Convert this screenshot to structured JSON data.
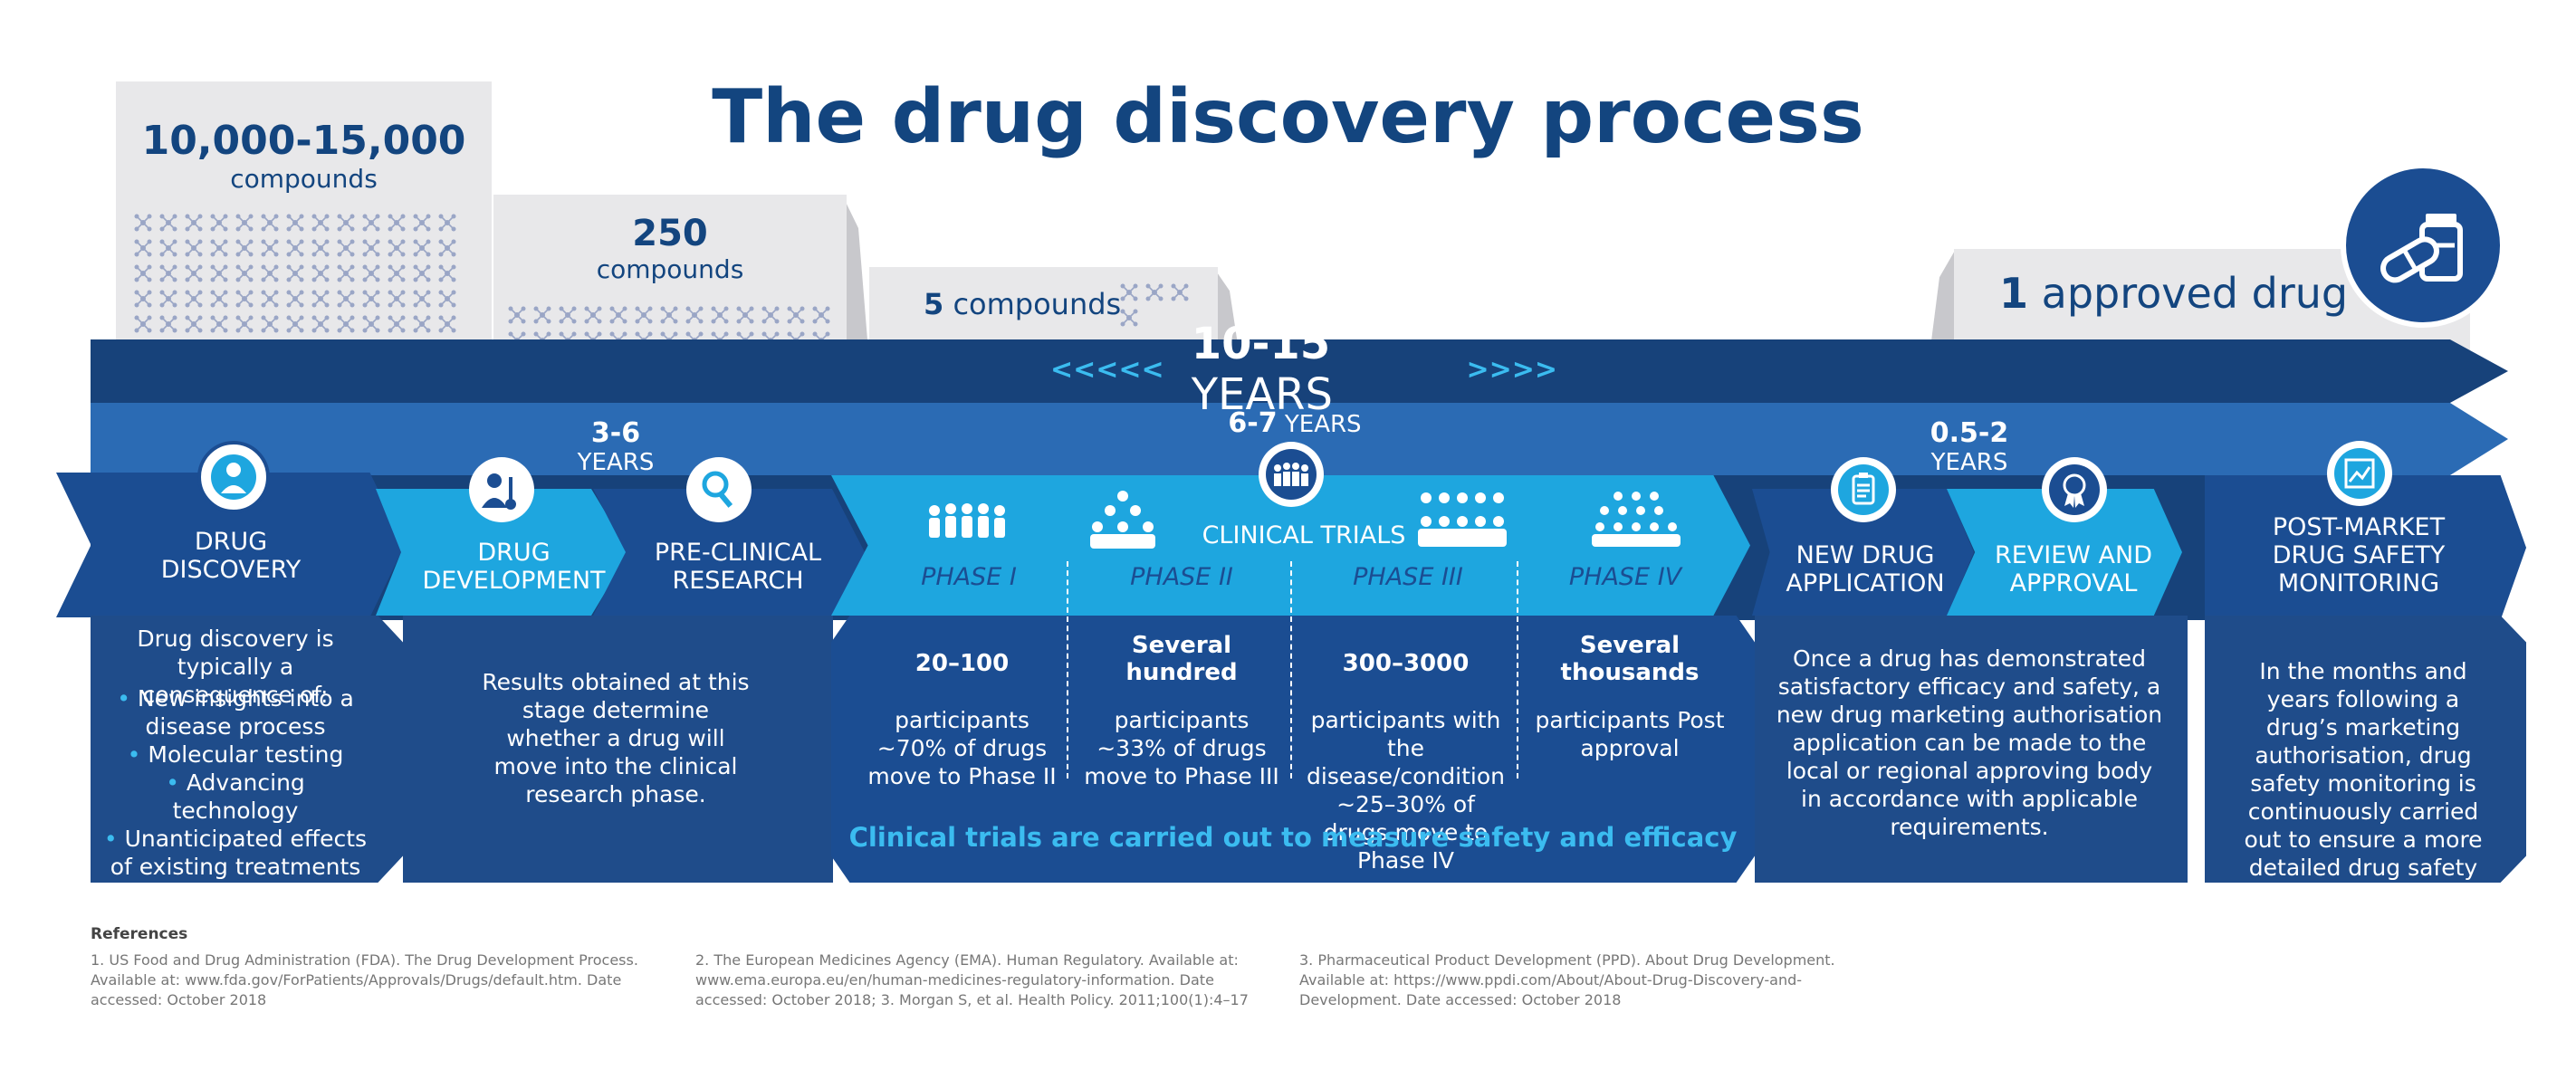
{
  "title": "The drug discovery process",
  "funnel": {
    "stage1_number": "10,000-15,000",
    "stage1_unit": "compounds",
    "stage2_number": "250",
    "stage2_unit": "compounds",
    "stage3_number": "5",
    "stage3_unit": "compounds",
    "final_number": "1",
    "final_unit": "approved drug"
  },
  "timeline": {
    "total_number": "10-15",
    "total_unit": "YEARS",
    "total_left_arrows": "<<<<<",
    "total_right_arrows": ">>>>",
    "dev_number": "3-6",
    "dev_unit": "YEARS",
    "clinical_number": "6-7",
    "clinical_unit": "YEARS",
    "approval_number": "0.5-2",
    "approval_unit": "YEARS"
  },
  "stages": {
    "drug_discovery": "DRUG DISCOVERY",
    "drug_development": "DRUG DEVELOPMENT",
    "preclinical": "PRE-CLINICAL RESEARCH",
    "clinical_trials": "CLINICAL TRIALS",
    "new_drug_application": "NEW DRUG APPLICATION",
    "review_approval": "REVIEW AND APPROVAL",
    "post_market": "POST-MARKET DRUG SAFETY MONITORING"
  },
  "phases": [
    {
      "label": "PHASE I",
      "count": "20–100",
      "desc": "participants ~70% of drugs move to Phase II"
    },
    {
      "label": "PHASE II",
      "count": "Several hundred",
      "desc": "participants ~33% of drugs move to Phase III"
    },
    {
      "label": "PHASE III",
      "count": "300–3000",
      "desc": "participants with the disease/condition ~25–30% of drugs move to Phase IV"
    },
    {
      "label": "PHASE IV",
      "count": "Several thousands",
      "desc": "participants Post approval"
    }
  ],
  "discovery_text": {
    "intro": "Drug discovery is typically a consequence of:",
    "bullets": [
      "New insights into a disease process",
      "Molecular testing",
      "Advancing technology",
      "Unanticipated effects of existing treatments"
    ]
  },
  "development_text": "Results obtained at this stage determine whether a drug will move into the clinical research phase.",
  "clinical_note": "Clinical trials are carried out to measure safety and efficacy",
  "application_text": "Once a drug has demonstrated satisfactory efficacy and safety, a new drug marketing authorisation application can be made to the local or regional approving body in accordance with applicable requirements.",
  "postmarket_text": "In the months and years following a drug’s marketing authorisation, drug safety monitoring is continuously carried out to ensure a more detailed drug safety profile.",
  "references": {
    "heading": "References",
    "items": [
      "1. US Food and Drug Administration (FDA). The Drug Development Process. Available at: www.fda.gov/ForPatients/Approvals/Drugs/default.htm. Date accessed: October 2018",
      "2. The European Medicines Agency (EMA). Human Regulatory. Available at: www.ema.europa.eu/en/human-medicines-regulatory-information. Date accessed: October 2018; 3. Morgan S, et al. Health Policy. 2011;100(1):4–17",
      "3. Pharmaceutical Product Development (PPD). About Drug Development. Available at: https://www.ppdi.com/About/About-Drug-Discovery-and-Development. Date accessed: October 2018"
    ]
  },
  "icons": [
    "scientist-icon",
    "researchers-icon",
    "microscope-icon",
    "team-icon",
    "crowd-icon",
    "clipboard-icon",
    "award-icon",
    "chart-icon",
    "pills-icon",
    "molecule-icon"
  ]
}
